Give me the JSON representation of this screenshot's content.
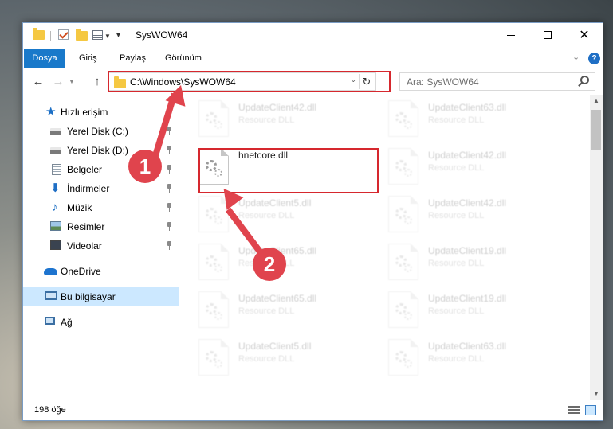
{
  "window": {
    "title": "SysWOW64"
  },
  "ribbon": {
    "tabs": [
      "Dosya",
      "Giriş",
      "Paylaş",
      "Görünüm"
    ],
    "help": "?"
  },
  "nav": {
    "back": "←",
    "forward": "→",
    "up": "↑",
    "address": "C:\\Windows\\SysWOW64",
    "refresh": "↻",
    "search_placeholder": "Ara: SysWOW64"
  },
  "sidebar": {
    "quick_access": "Hızlı erişim",
    "items": [
      {
        "label": "Yerel Disk (C:)",
        "icon": "drive-icon"
      },
      {
        "label": "Yerel Disk (D:)",
        "icon": "drive-icon"
      },
      {
        "label": "Belgeler",
        "icon": "documents-icon"
      },
      {
        "label": "İndirmeler",
        "icon": "downloads-icon"
      },
      {
        "label": "Müzik",
        "icon": "music-icon"
      },
      {
        "label": "Resimler",
        "icon": "pictures-icon"
      },
      {
        "label": "Videolar",
        "icon": "videos-icon"
      }
    ],
    "onedrive": "OneDrive",
    "this_pc": "Bu bilgisayar",
    "network": "Ağ"
  },
  "files": {
    "left": [
      {
        "name": "UpdateClient42.dll",
        "type": "Resource DLL"
      },
      {
        "name": "hnetcore.dll",
        "type": ""
      },
      {
        "name": "UpdateClient5.dll",
        "type": "Resource DLL"
      },
      {
        "name": "UpdateClient65.dll",
        "type": "Resource DLL"
      },
      {
        "name": "UpdateClient65.dll",
        "type": "Resource DLL"
      },
      {
        "name": "UpdateClient5.dll",
        "type": "Resource DLL"
      }
    ],
    "right": [
      {
        "name": "UpdateClient63.dll",
        "type": "Resource DLL"
      },
      {
        "name": "UpdateClient42.dll",
        "type": "Resource DLL"
      },
      {
        "name": "UpdateClient42.dll",
        "type": "Resource DLL"
      },
      {
        "name": "UpdateClient19.dll",
        "type": "Resource DLL"
      },
      {
        "name": "UpdateClient19.dll",
        "type": "Resource DLL"
      },
      {
        "name": "UpdateClient63.dll",
        "type": "Resource DLL"
      }
    ]
  },
  "status": {
    "item_count": "198 öğe"
  },
  "annotations": {
    "step1": "1",
    "step2": "2",
    "color": "#e0444d",
    "highlight_color": "#d6282e"
  },
  "colors": {
    "file_tab": "#1979ca",
    "selection": "#cce8ff"
  }
}
